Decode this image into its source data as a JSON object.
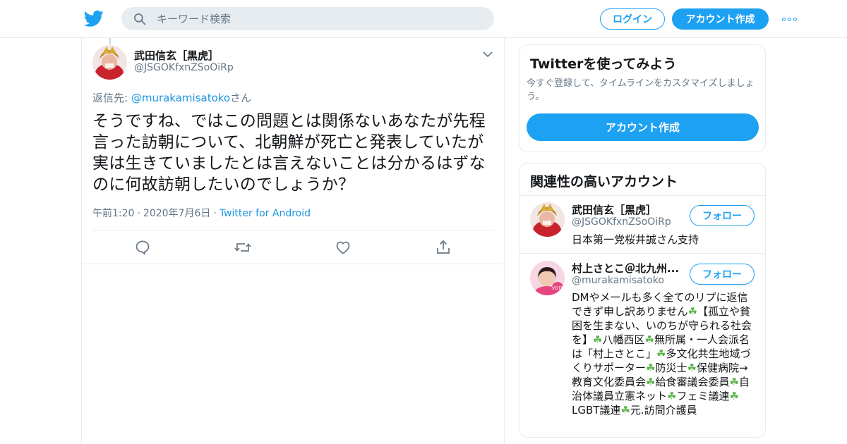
{
  "header": {
    "search_placeholder": "キーワード検索",
    "login_label": "ログイン",
    "signup_label": "アカウント作成"
  },
  "tweet": {
    "author_name": "武田信玄［黒虎］",
    "author_handle": "@JSGOKfxnZSoOiRp",
    "reply_prefix": "返信先: ",
    "reply_mention": "@murakamisatoko",
    "reply_suffix": "さん",
    "text": "そうですね、ではこの問題とは関係ないあなたが先程言った訪朝について、北朝鮮が死亡と発表していたが実は生きていましたとは言えないことは分かるはずなのに何故訪朝したいのでしょうか？",
    "time": "午前1:20",
    "date": "2020年7月6日",
    "source": "Twitter for Android"
  },
  "signup_card": {
    "title": "Twitterを使ってみよう",
    "description": "今すぐ登録して、タイムラインをカスタマイズしましょう。",
    "button_label": "アカウント作成"
  },
  "related": {
    "title": "関連性の高いアカウント",
    "follow_label": "フォロー",
    "accounts": [
      {
        "name": "武田信玄［黒虎］",
        "handle": "@JSGOKfxnZSoOiRp",
        "bio": "日本第一党桜井誠さん支持"
      },
      {
        "name": "村上さとこ＠北九州...",
        "handle": "@murakamisatoko",
        "bio_parts": [
          "DMやメールも多く全てのリプに返信できず申し訳ありません",
          "【孤立や貧困を生まない、いのちが守られる社会を】",
          "八幡西区",
          "無所属・一人会派名は「村上さとこ」",
          "多文化共生地域づくりサポーター",
          "防災士",
          "保健病院→教育文化委員会",
          "給食審議会委員",
          "自治体議員立憲ネット",
          "フェミ議連",
          "LGBT議連",
          "元.訪問介護員"
        ]
      }
    ]
  },
  "colors": {
    "brand": "#1da1f2",
    "link": "#1b95e0",
    "muted": "#657786",
    "border": "#e6ecf0"
  }
}
